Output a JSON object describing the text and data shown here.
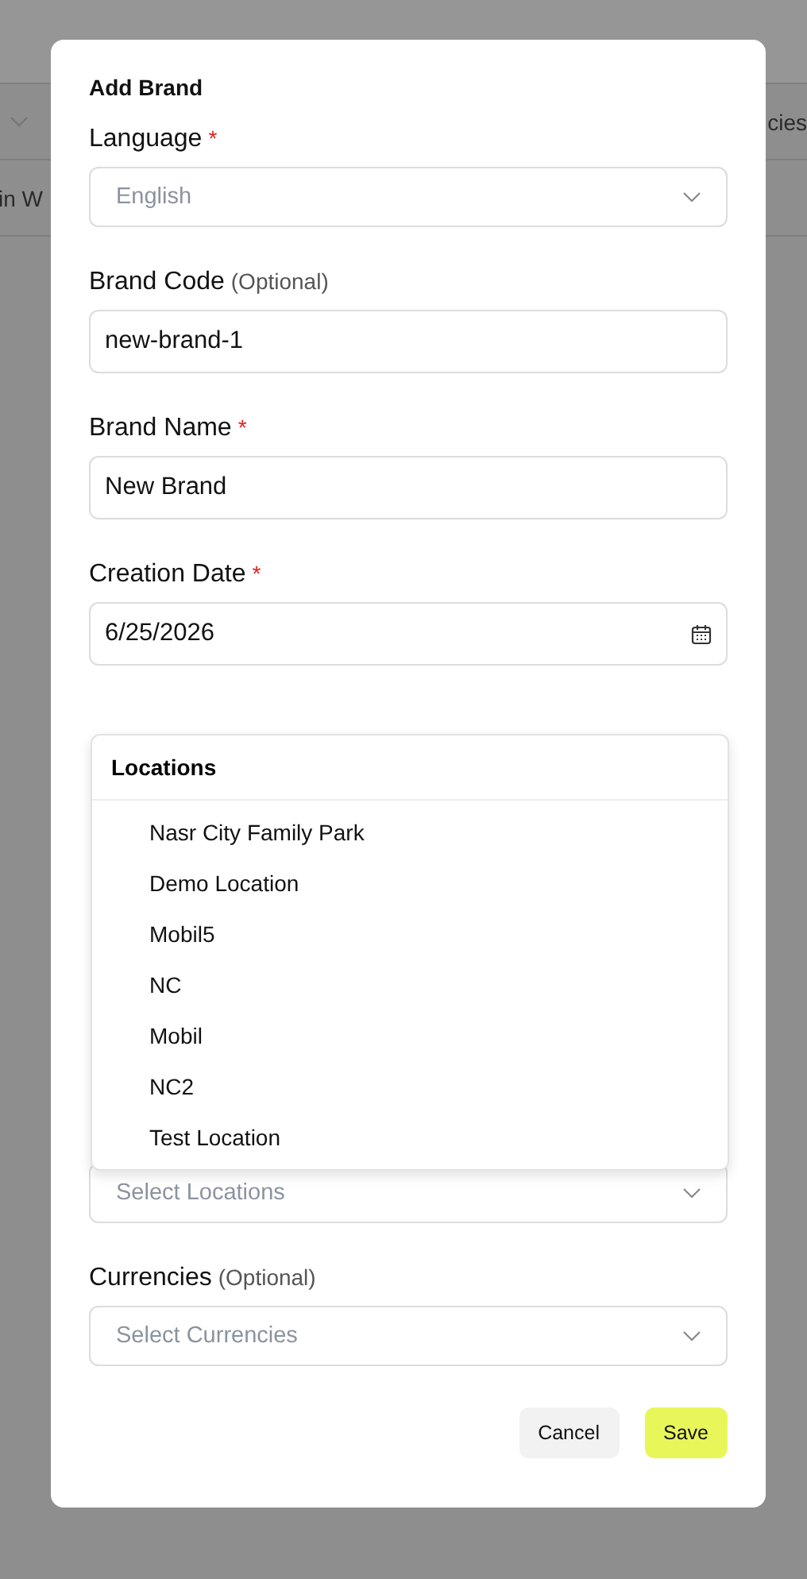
{
  "background": {
    "header_text": "cies",
    "cell_text": "in W"
  },
  "dialog": {
    "title": "Add Brand",
    "fields": [
      {
        "kind": "select",
        "label": "Language",
        "required_mark": "*",
        "placeholder": "English"
      },
      {
        "kind": "text",
        "label": "Brand Code",
        "optional": "(Optional)",
        "value": "new-brand-1"
      },
      {
        "kind": "text",
        "label": "Brand Name",
        "required_mark": "*",
        "value": "New Brand"
      },
      {
        "kind": "date",
        "label": "Creation Date",
        "required_mark": "*",
        "value": "6/25/2026"
      },
      {
        "kind": "hidden"
      },
      {
        "kind": "select",
        "placeholder": "Select Locations"
      },
      {
        "kind": "select",
        "label": "Currencies",
        "optional": "(Optional)",
        "placeholder": "Select Currencies"
      }
    ],
    "dropdown": {
      "title": "Locations",
      "items": [
        "Nasr City Family Park",
        "Demo Location",
        "Mobil5",
        "NC",
        "Mobil",
        "NC2",
        "Test Location"
      ]
    },
    "buttons": [
      {
        "kind": "secondary",
        "label": "Cancel"
      },
      {
        "kind": "primary",
        "label": "Save"
      }
    ]
  }
}
